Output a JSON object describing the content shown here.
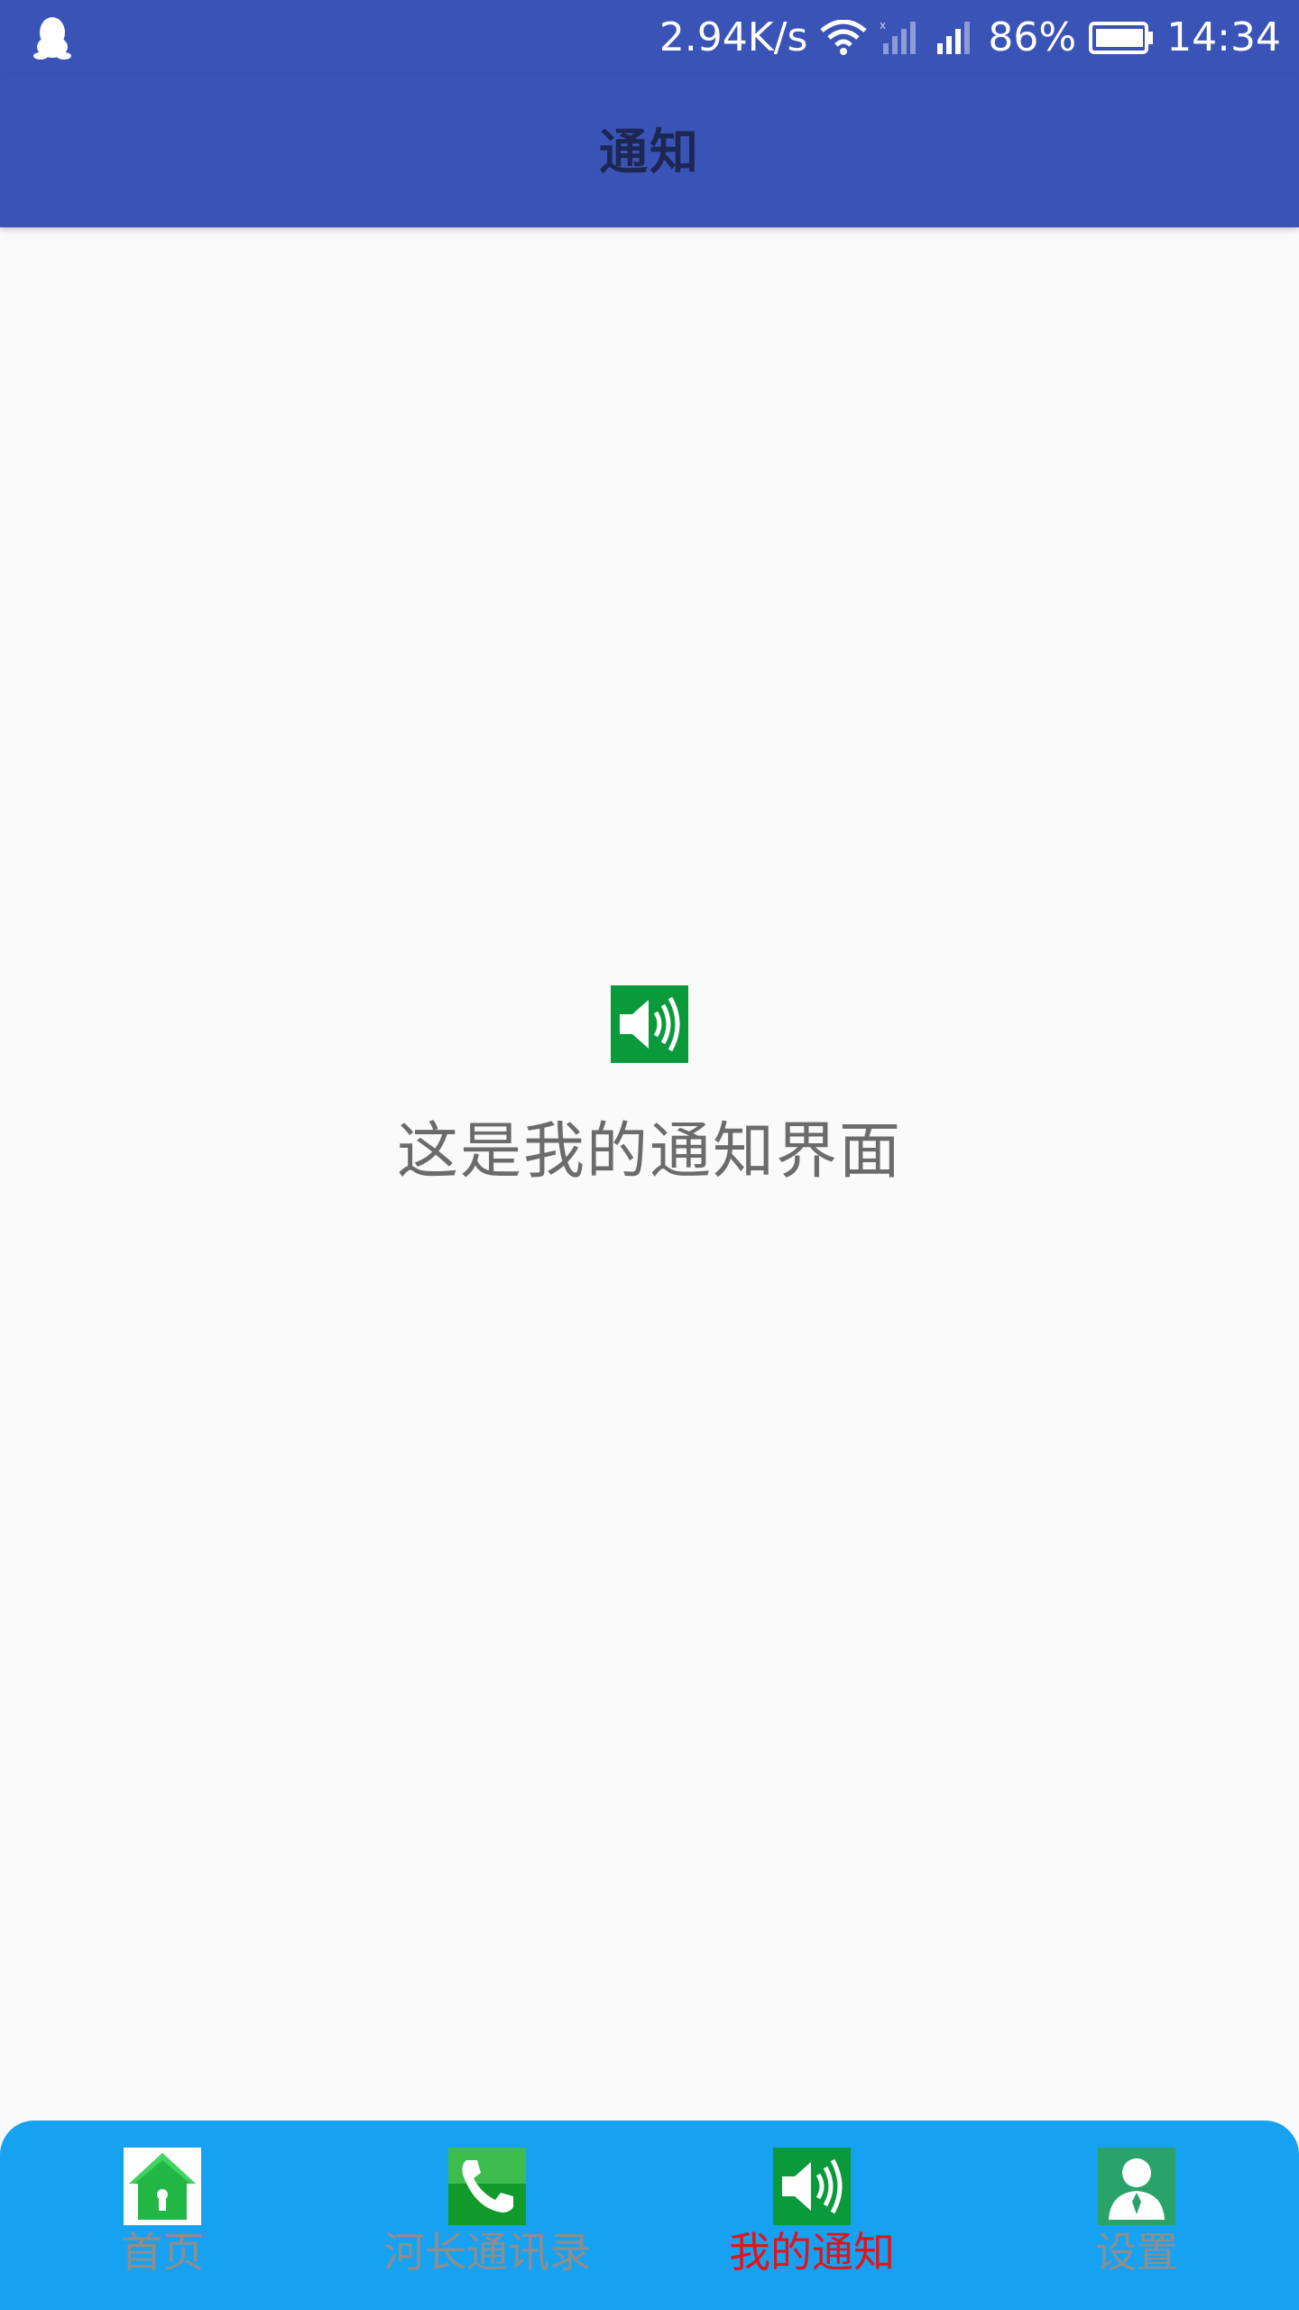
{
  "status_bar": {
    "app_icon": "qq-penguin-icon",
    "network_speed": "2.94K/s",
    "battery_percent": "86%",
    "time": "14:34",
    "icons": [
      "wifi-icon",
      "signal-no-sim-icon",
      "signal-icon",
      "battery-icon"
    ]
  },
  "app_bar": {
    "title": "通知"
  },
  "main": {
    "icon": "speaker-icon",
    "message": "这是我的通知界面"
  },
  "bottom_nav": {
    "items": [
      {
        "label": "首页",
        "icon": "home-icon",
        "active": false
      },
      {
        "label": "河长通讯录",
        "icon": "phone-icon",
        "active": false
      },
      {
        "label": "我的通知",
        "icon": "speaker-icon",
        "active": true
      },
      {
        "label": "设置",
        "icon": "user-icon",
        "active": false
      }
    ],
    "active_color": "#e3131a",
    "inactive_color": "#8e8e8e",
    "background": "#17a2f1"
  },
  "colors": {
    "primary": "#3a53b7",
    "title_text": "#1c2752",
    "body_text": "#6b6b6b",
    "page_background": "#fafafa"
  }
}
